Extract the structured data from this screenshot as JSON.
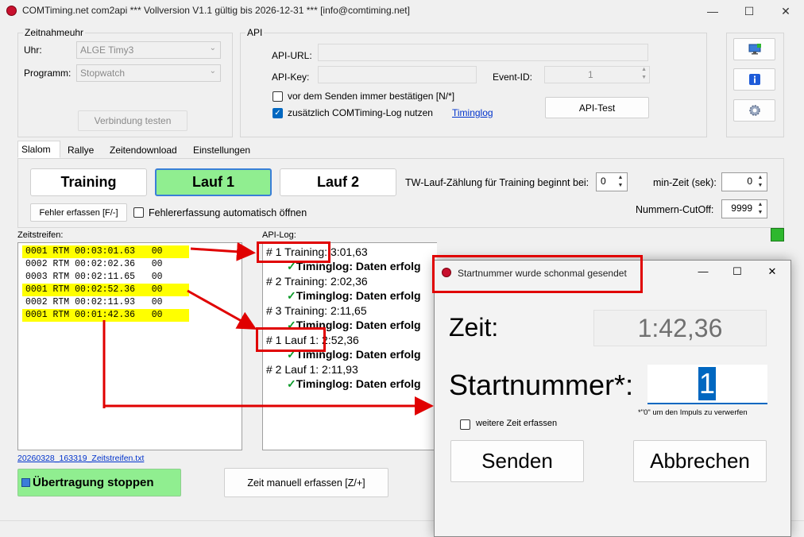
{
  "window": {
    "title": "COMTiming.net com2api *** Vollversion V1.1 gültig bis 2026-12-31 *** [info@comtiming.net]",
    "min_glyph": "—",
    "max_glyph": "☐",
    "close_glyph": "✕"
  },
  "zeitnahmeuhr": {
    "group_label": "Zeitnahmeuhr",
    "uhr_label": "Uhr:",
    "uhr_value": "ALGE Timy3",
    "programm_label": "Programm:",
    "programm_value": "Stopwatch",
    "test_button": "Verbindung testen"
  },
  "api": {
    "group_label": "API",
    "url_label": "API-URL:",
    "url_value": "",
    "key_label": "API-Key:",
    "key_value": "",
    "event_label": "Event-ID:",
    "event_value": "1",
    "confirm_checkbox": "vor dem Senden immer bestätigen [N/*]",
    "confirm_checked": false,
    "log_checkbox": "zusätzlich COMTiming-Log nutzen",
    "log_checked": true,
    "timinglog_link": "Timinglog",
    "test_button": "API-Test"
  },
  "side_icons": [
    "monitor-icon",
    "info-icon",
    "settings-gear-icon"
  ],
  "tabs": [
    "Slalom",
    "Rallye",
    "Zeitendownload",
    "Einstellungen"
  ],
  "active_tab": 0,
  "slalom": {
    "training": "Training",
    "lauf1": "Lauf 1",
    "lauf2": "Lauf 2",
    "active_run": "lauf1",
    "active_color": "#90ee90",
    "tw_label": "TW-Lauf-Zählung für Training beginnt bei:",
    "tw_value": "0",
    "minzeit_label": "min-Zeit (sek):",
    "minzeit_value": "0",
    "fehler_button": "Fehler erfassen [F/-]",
    "fehler_auto_checkbox": "Fehlererfassung automatisch öffnen",
    "fehler_auto_checked": false,
    "cutoff_label": "Nummern-CutOff:",
    "cutoff_value": "9999"
  },
  "zeitstreifen": {
    "label": "Zeitstreifen:",
    "rows": [
      {
        "text": "0001 RTM 00:03:01.63   00",
        "highlight": true
      },
      {
        "text": "0002 RTM 00:02:02.36   00",
        "highlight": false
      },
      {
        "text": "0003 RTM 00:02:11.65   00",
        "highlight": false
      },
      {
        "text": "0001 RTM 00:02:52.36   00",
        "highlight": true
      },
      {
        "text": "0002 RTM 00:02:11.93   00",
        "highlight": false
      },
      {
        "text": "0001 RTM 00:01:42.36   00",
        "highlight": true
      }
    ],
    "file_link": "20260328_163319_Zeitstreifen.txt",
    "highlight_color": "#ffff00"
  },
  "apilog": {
    "label": "API-Log:",
    "status_color": "#2eb82e",
    "rows": [
      {
        "text": "#  1 Training: 3:01,63",
        "sub": false
      },
      {
        "text": "Timinglog: Daten erfolg",
        "sub": true
      },
      {
        "text": "#  2 Training: 2:02,36",
        "sub": false
      },
      {
        "text": "Timinglog: Daten erfolg",
        "sub": true
      },
      {
        "text": "#  3 Training: 2:11,65",
        "sub": false
      },
      {
        "text": "Timinglog: Daten erfolg",
        "sub": true
      },
      {
        "text": "#  1 Lauf 1: 2:52,36",
        "sub": false
      },
      {
        "text": "Timinglog: Daten erfolg",
        "sub": true
      },
      {
        "text": "#  2 Lauf 1: 2:11,93",
        "sub": false
      },
      {
        "text": "Timinglog: Daten erfolg",
        "sub": true
      }
    ],
    "checkmark": "✓"
  },
  "bottom": {
    "stop_button": "Übertragung stoppen",
    "stop_color": "#90ee90",
    "manual_button": "Zeit manuell erfassen [Z/+]"
  },
  "dialog": {
    "title": "Startnummer wurde schonmal gesendet",
    "zeit_label": "Zeit:",
    "zeit_value": "1:42,36",
    "startnummer_label": "Startnummer*:",
    "startnummer_value": "1",
    "hint": "*\"0\" um den Impuls zu verwerfen",
    "weitere_checkbox": "weitere Zeit erfassen",
    "weitere_checked": false,
    "send_button": "Senden",
    "cancel_button": "Abbrechen",
    "min_glyph": "—",
    "max_glyph": "☐",
    "close_glyph": "✕"
  }
}
